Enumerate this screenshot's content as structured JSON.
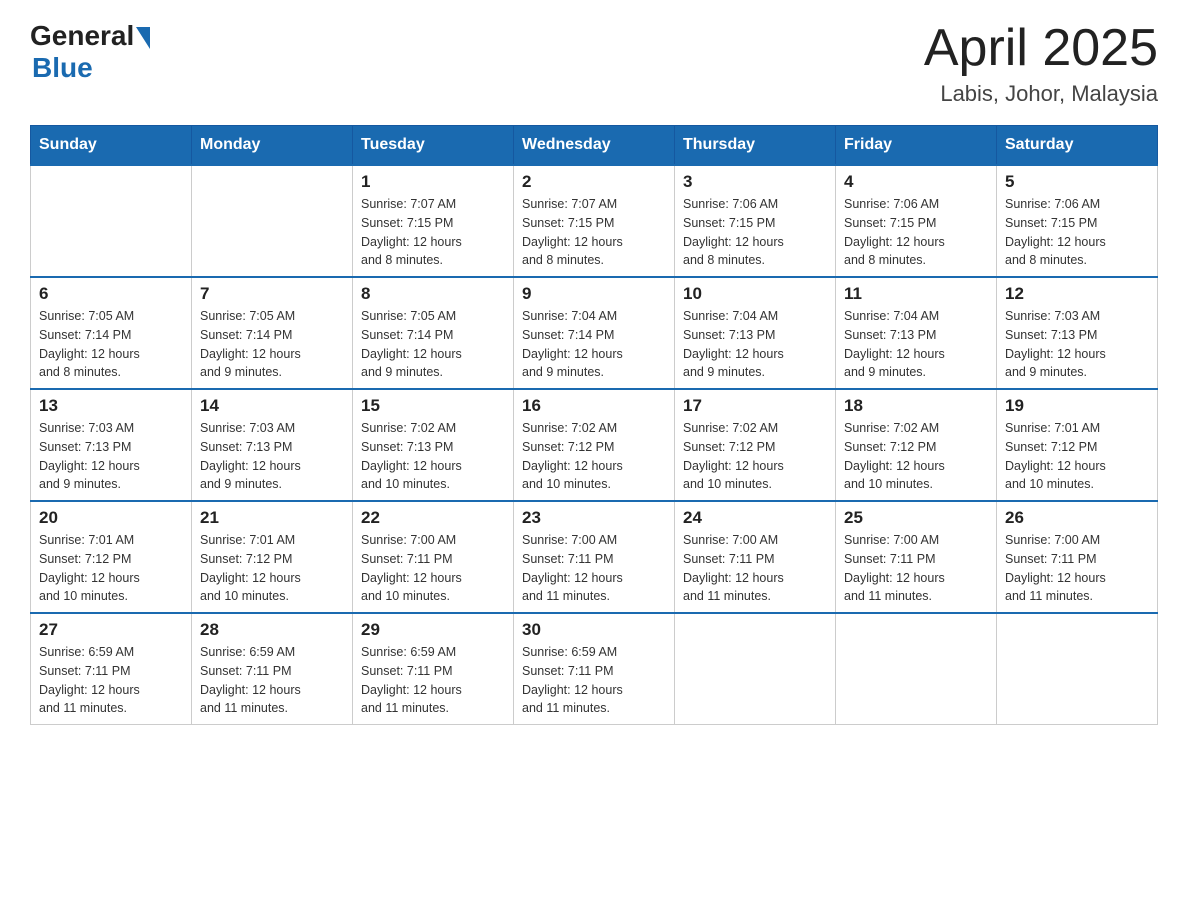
{
  "header": {
    "logo": {
      "general": "General",
      "blue": "Blue"
    },
    "title": "April 2025",
    "location": "Labis, Johor, Malaysia"
  },
  "weekdays": [
    "Sunday",
    "Monday",
    "Tuesday",
    "Wednesday",
    "Thursday",
    "Friday",
    "Saturday"
  ],
  "weeks": [
    [
      {
        "day": "",
        "info": ""
      },
      {
        "day": "",
        "info": ""
      },
      {
        "day": "1",
        "sunrise": "7:07 AM",
        "sunset": "7:15 PM",
        "daylight": "12 hours and 8 minutes."
      },
      {
        "day": "2",
        "sunrise": "7:07 AM",
        "sunset": "7:15 PM",
        "daylight": "12 hours and 8 minutes."
      },
      {
        "day": "3",
        "sunrise": "7:06 AM",
        "sunset": "7:15 PM",
        "daylight": "12 hours and 8 minutes."
      },
      {
        "day": "4",
        "sunrise": "7:06 AM",
        "sunset": "7:15 PM",
        "daylight": "12 hours and 8 minutes."
      },
      {
        "day": "5",
        "sunrise": "7:06 AM",
        "sunset": "7:15 PM",
        "daylight": "12 hours and 8 minutes."
      }
    ],
    [
      {
        "day": "6",
        "sunrise": "7:05 AM",
        "sunset": "7:14 PM",
        "daylight": "12 hours and 8 minutes."
      },
      {
        "day": "7",
        "sunrise": "7:05 AM",
        "sunset": "7:14 PM",
        "daylight": "12 hours and 9 minutes."
      },
      {
        "day": "8",
        "sunrise": "7:05 AM",
        "sunset": "7:14 PM",
        "daylight": "12 hours and 9 minutes."
      },
      {
        "day": "9",
        "sunrise": "7:04 AM",
        "sunset": "7:14 PM",
        "daylight": "12 hours and 9 minutes."
      },
      {
        "day": "10",
        "sunrise": "7:04 AM",
        "sunset": "7:13 PM",
        "daylight": "12 hours and 9 minutes."
      },
      {
        "day": "11",
        "sunrise": "7:04 AM",
        "sunset": "7:13 PM",
        "daylight": "12 hours and 9 minutes."
      },
      {
        "day": "12",
        "sunrise": "7:03 AM",
        "sunset": "7:13 PM",
        "daylight": "12 hours and 9 minutes."
      }
    ],
    [
      {
        "day": "13",
        "sunrise": "7:03 AM",
        "sunset": "7:13 PM",
        "daylight": "12 hours and 9 minutes."
      },
      {
        "day": "14",
        "sunrise": "7:03 AM",
        "sunset": "7:13 PM",
        "daylight": "12 hours and 9 minutes."
      },
      {
        "day": "15",
        "sunrise": "7:02 AM",
        "sunset": "7:13 PM",
        "daylight": "12 hours and 10 minutes."
      },
      {
        "day": "16",
        "sunrise": "7:02 AM",
        "sunset": "7:12 PM",
        "daylight": "12 hours and 10 minutes."
      },
      {
        "day": "17",
        "sunrise": "7:02 AM",
        "sunset": "7:12 PM",
        "daylight": "12 hours and 10 minutes."
      },
      {
        "day": "18",
        "sunrise": "7:02 AM",
        "sunset": "7:12 PM",
        "daylight": "12 hours and 10 minutes."
      },
      {
        "day": "19",
        "sunrise": "7:01 AM",
        "sunset": "7:12 PM",
        "daylight": "12 hours and 10 minutes."
      }
    ],
    [
      {
        "day": "20",
        "sunrise": "7:01 AM",
        "sunset": "7:12 PM",
        "daylight": "12 hours and 10 minutes."
      },
      {
        "day": "21",
        "sunrise": "7:01 AM",
        "sunset": "7:12 PM",
        "daylight": "12 hours and 10 minutes."
      },
      {
        "day": "22",
        "sunrise": "7:00 AM",
        "sunset": "7:11 PM",
        "daylight": "12 hours and 10 minutes."
      },
      {
        "day": "23",
        "sunrise": "7:00 AM",
        "sunset": "7:11 PM",
        "daylight": "12 hours and 11 minutes."
      },
      {
        "day": "24",
        "sunrise": "7:00 AM",
        "sunset": "7:11 PM",
        "daylight": "12 hours and 11 minutes."
      },
      {
        "day": "25",
        "sunrise": "7:00 AM",
        "sunset": "7:11 PM",
        "daylight": "12 hours and 11 minutes."
      },
      {
        "day": "26",
        "sunrise": "7:00 AM",
        "sunset": "7:11 PM",
        "daylight": "12 hours and 11 minutes."
      }
    ],
    [
      {
        "day": "27",
        "sunrise": "6:59 AM",
        "sunset": "7:11 PM",
        "daylight": "12 hours and 11 minutes."
      },
      {
        "day": "28",
        "sunrise": "6:59 AM",
        "sunset": "7:11 PM",
        "daylight": "12 hours and 11 minutes."
      },
      {
        "day": "29",
        "sunrise": "6:59 AM",
        "sunset": "7:11 PM",
        "daylight": "12 hours and 11 minutes."
      },
      {
        "day": "30",
        "sunrise": "6:59 AM",
        "sunset": "7:11 PM",
        "daylight": "12 hours and 11 minutes."
      },
      {
        "day": "",
        "info": ""
      },
      {
        "day": "",
        "info": ""
      },
      {
        "day": "",
        "info": ""
      }
    ]
  ],
  "labels": {
    "sunrise": "Sunrise:",
    "sunset": "Sunset:",
    "daylight": "Daylight:"
  }
}
